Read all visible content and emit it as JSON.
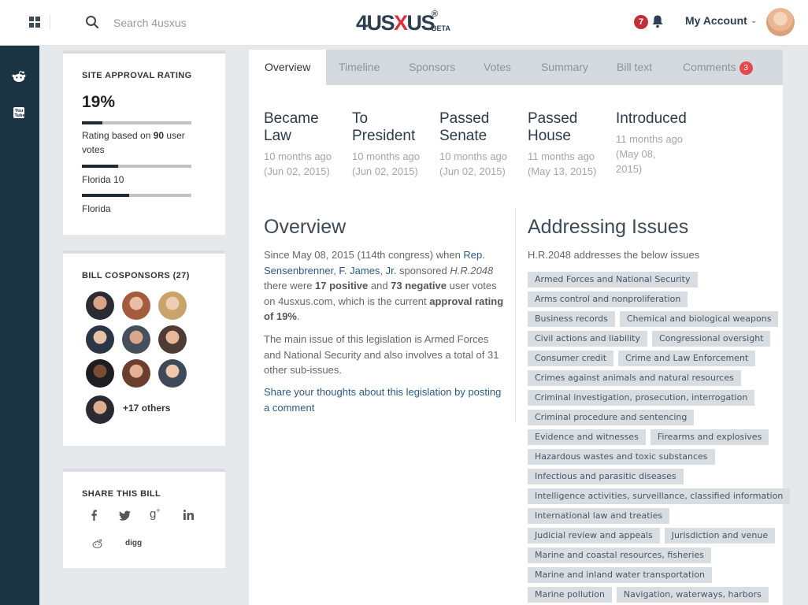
{
  "header": {
    "search_placeholder": "Search 4usxus",
    "logo_text_a": "4US",
    "logo_text_x": "X",
    "logo_text_b": "US",
    "logo_reg": "®",
    "logo_beta": "BETA",
    "notification_count": "7",
    "account_label": "My Account"
  },
  "sidebar": {
    "approval": {
      "title": "SITE APPROVAL RATING",
      "value": "19%",
      "rating_text_prefix": "Rating based on ",
      "rating_votes": "90",
      "rating_text_suffix": " user votes",
      "district_label": "Florida 10",
      "state_label": "Florida",
      "fills": [
        0.19,
        0.33,
        0.43
      ]
    },
    "cosponsors": {
      "title": "BILL COSPONSORS (27)",
      "others": "+17 others"
    },
    "share": {
      "title": "SHARE THIS BILL",
      "icons": [
        "facebook-icon",
        "twitter-icon",
        "google-plus-icon",
        "linkedin-icon",
        "reddit-icon",
        "digg-icon"
      ],
      "digg_label": "digg"
    }
  },
  "tabs": [
    {
      "label": "Overview"
    },
    {
      "label": "Timeline"
    },
    {
      "label": "Sponsors"
    },
    {
      "label": "Votes"
    },
    {
      "label": "Summary"
    },
    {
      "label": "Bill text"
    },
    {
      "label": "Comments",
      "badge": "3"
    }
  ],
  "statuses": [
    {
      "title": "Became Law",
      "date": "10 months ago (Jun 02, 2015)"
    },
    {
      "title": "To President",
      "date": "10 months ago (Jun 02, 2015)"
    },
    {
      "title": "Passed Senate",
      "date": "10 months ago (Jun 02, 2015)"
    },
    {
      "title": "Passed House",
      "date": "11 months ago (May 13, 2015)"
    },
    {
      "title": "Introduced",
      "date": "11 months ago (May 08, 2015)"
    }
  ],
  "overview": {
    "heading": "Overview",
    "p1_a": "Since May 08, 2015 (114th congress) when ",
    "p1_sponsor_1": "Rep.",
    "p1_sponsor_2": "Sensenbrenner",
    "p1_sponsor_3": "F. James",
    "p1_sponsor_4": "Jr.",
    "p1_b": " sponsored ",
    "p1_bill": "H.R.2048",
    "p1_c": " there were ",
    "p1_pos": "17 positive",
    "p1_d": " and ",
    "p1_neg": "73 negative",
    "p1_e": " user votes on 4usxus.com, which is the current ",
    "p1_rating": "approval rating of 19%",
    "p1_f": ".",
    "p2": "The main issue of this legislation is Armed Forces and National Security and also involves a total of 31 other sub-issues.",
    "p3": "Share your thoughts about this legislation by posting a comment"
  },
  "issues": {
    "heading": "Addressing Issues",
    "intro": "H.R.2048 addresses the below issues",
    "rows": [
      [
        "Armed Forces and National Security"
      ],
      [
        "Arms control and nonproliferation"
      ],
      [
        "Business records",
        "Chemical and biological weapons"
      ],
      [
        "Civil actions and liability",
        "Congressional oversight"
      ],
      [
        "Consumer credit",
        "Crime and Law Enforcement"
      ],
      [
        "Crimes against animals and natural resources"
      ],
      [
        "Criminal investigation, prosecution, interrogation"
      ],
      [
        "Criminal procedure and sentencing"
      ],
      [
        "Evidence and witnesses",
        "Firearms and explosives"
      ],
      [
        "Hazardous wastes and toxic substances"
      ],
      [
        "Infectious and parasitic diseases"
      ],
      [
        "Intelligence activities, surveillance, classified information"
      ],
      [
        "International law and treaties"
      ],
      [
        "Judicial review and appeals",
        "Jurisdiction and venue"
      ],
      [
        "Marine and coastal resources, fisheries"
      ],
      [
        "Marine and inland water transportation"
      ],
      [
        "Marine pollution",
        "Navigation, waterways, harbors"
      ]
    ]
  },
  "colors": {
    "rail": "#1a3443",
    "accent_red": "#d8323c",
    "link": "#2b5a85"
  }
}
